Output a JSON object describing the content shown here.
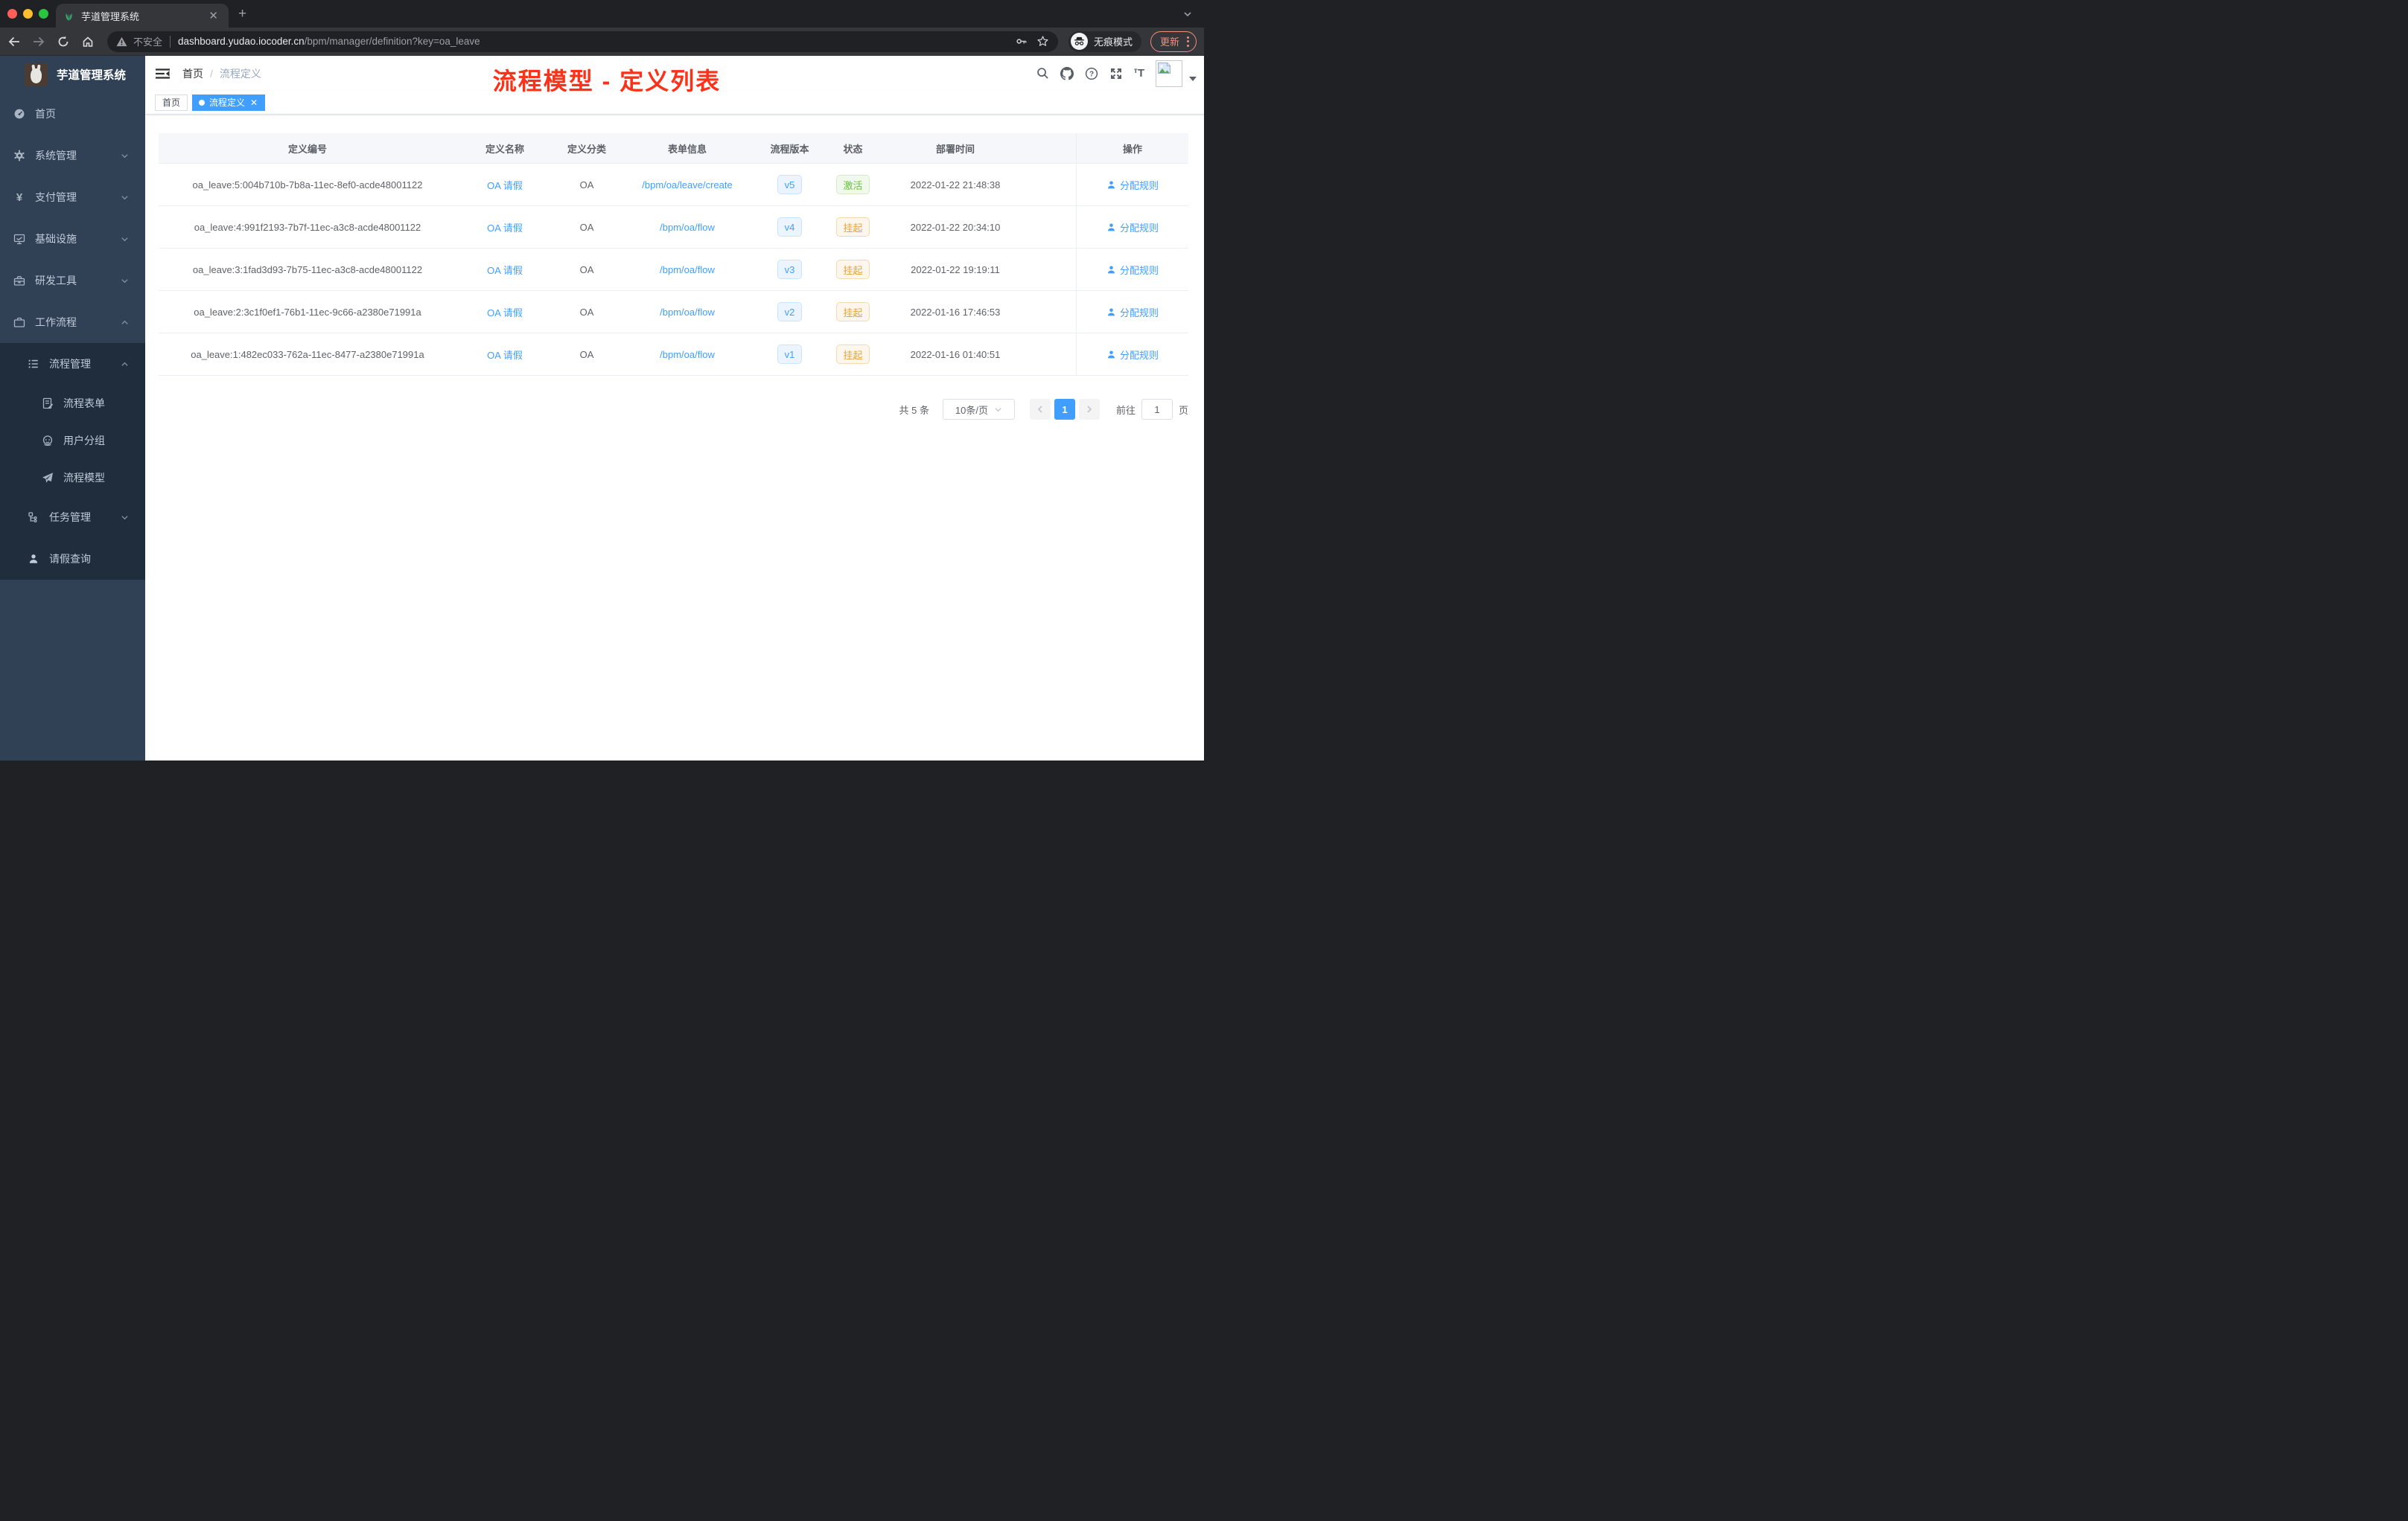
{
  "browser": {
    "tab_title": "芋道管理系统",
    "toolbar": {
      "security_label": "不安全",
      "url_host": "dashboard.yudao.iocoder.cn",
      "url_path": "/bpm/manager/definition?key=oa_leave",
      "incognito_label": "无痕模式",
      "update_label": "更新"
    }
  },
  "sidebar": {
    "logo_title": "芋道管理系统",
    "items": [
      {
        "icon": "dashboard-icon",
        "label": "首页"
      },
      {
        "icon": "gear-icon",
        "label": "系统管理"
      },
      {
        "icon": "yen-icon",
        "label": "支付管理"
      },
      {
        "icon": "monitor-icon",
        "label": "基础设施"
      },
      {
        "icon": "toolbox-icon",
        "label": "研发工具"
      },
      {
        "icon": "briefcase-icon",
        "label": "工作流程"
      }
    ],
    "submenu": [
      {
        "icon": "list-icon",
        "label": "流程管理"
      },
      {
        "icon": "form-icon",
        "label": "流程表单"
      },
      {
        "icon": "robot-icon",
        "label": "用户分组"
      },
      {
        "icon": "plane-icon",
        "label": "流程模型"
      },
      {
        "icon": "tree-icon",
        "label": "任务管理"
      },
      {
        "icon": "user-icon",
        "label": "请假查询"
      }
    ]
  },
  "header": {
    "breadcrumb": {
      "home": "首页",
      "current": "流程定义"
    },
    "annotation": "流程模型 - 定义列表"
  },
  "tags": {
    "home": "首页",
    "active": "流程定义"
  },
  "table": {
    "headers": [
      "定义编号",
      "定义名称",
      "定义分类",
      "表单信息",
      "流程版本",
      "状态",
      "部署时间",
      "操作"
    ],
    "action_label": "分配规则",
    "rows": [
      {
        "id": "oa_leave:5:004b710b-7b8a-11ec-8ef0-acde48001122",
        "name": "OA 请假",
        "category": "OA",
        "form": "/bpm/oa/leave/create",
        "version": "v5",
        "status": "激活",
        "time": "2022-01-22 21:48:38"
      },
      {
        "id": "oa_leave:4:991f2193-7b7f-11ec-a3c8-acde48001122",
        "name": "OA 请假",
        "category": "OA",
        "form": "/bpm/oa/flow",
        "version": "v4",
        "status": "挂起",
        "time": "2022-01-22 20:34:10"
      },
      {
        "id": "oa_leave:3:1fad3d93-7b75-11ec-a3c8-acde48001122",
        "name": "OA 请假",
        "category": "OA",
        "form": "/bpm/oa/flow",
        "version": "v3",
        "status": "挂起",
        "time": "2022-01-22 19:19:11"
      },
      {
        "id": "oa_leave:2:3c1f0ef1-76b1-11ec-9c66-a2380e71991a",
        "name": "OA 请假",
        "category": "OA",
        "form": "/bpm/oa/flow",
        "version": "v2",
        "status": "挂起",
        "time": "2022-01-16 17:46:53"
      },
      {
        "id": "oa_leave:1:482ec033-762a-11ec-8477-a2380e71991a",
        "name": "OA 请假",
        "category": "OA",
        "form": "/bpm/oa/flow",
        "version": "v1",
        "status": "挂起",
        "time": "2022-01-16 01:40:51"
      }
    ]
  },
  "pagination": {
    "total_label": "共 5 条",
    "page_size": "10条/页",
    "current_page": "1",
    "goto_label": "前往",
    "goto_value": "1",
    "page_unit": "页"
  },
  "colors": {
    "accent": "#409eff",
    "status_active": "#67c23a",
    "status_suspended": "#e6a23c",
    "annotation_red": "#fb3118",
    "sidebar_bg": "#304156",
    "submenu_bg": "#1f2d3d"
  }
}
